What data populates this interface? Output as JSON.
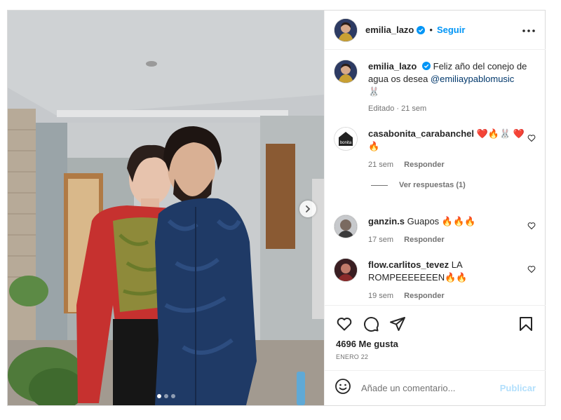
{
  "post": {
    "author": "emilia_lazo",
    "follow_label": "Seguir",
    "separator": "•",
    "caption_text": "Feliz año del conejo de agua os desea ",
    "caption_mention": "@emiliaypablomusic",
    "caption_emoji": "🐰",
    "caption_meta": "Editado · 21 sem",
    "likes": "4696 Me gusta",
    "date": "ENERO 22",
    "carousel": {
      "total": 3,
      "active_index": 0
    }
  },
  "comments": [
    {
      "user": "casabonita_carabanchel",
      "text": "❤️🔥🐰 ❤️🔥",
      "time": "21 sem",
      "reply_label": "Responder",
      "view_replies": "Ver respuestas (1)",
      "avatar_text": "bonita"
    },
    {
      "user": "ganzin.s",
      "text": "Guapos 🔥🔥🔥",
      "time": "17 sem",
      "reply_label": "Responder"
    },
    {
      "user": "flow.carlitos_tevez",
      "text": "LA ROMPEEEEEEEN🔥🔥",
      "time": "19 sem",
      "reply_label": "Responder"
    }
  ],
  "add_comment": {
    "placeholder": "Añade un comentario...",
    "publish_label": "Publicar"
  },
  "colors": {
    "accent": "#0095f6",
    "publish_disabled": "#b2dffc",
    "verified": "#0095f6",
    "muted": "#737373"
  },
  "icons": [
    "more-icon",
    "verified-icon",
    "heart-icon",
    "comment-icon",
    "share-icon",
    "bookmark-icon",
    "emoji-icon",
    "next-icon"
  ]
}
